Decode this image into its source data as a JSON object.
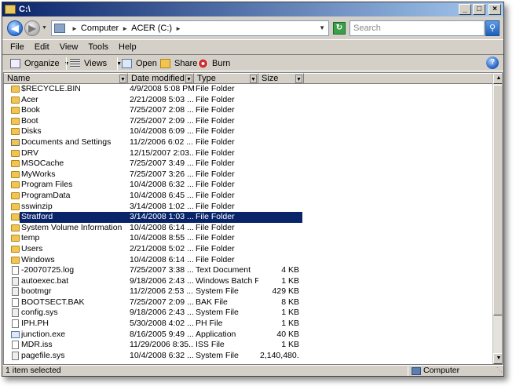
{
  "window": {
    "title": "C:\\"
  },
  "address": {
    "segments": [
      "Computer",
      "ACER (C:)"
    ],
    "search_placeholder": "Search"
  },
  "menu": [
    "File",
    "Edit",
    "View",
    "Tools",
    "Help"
  ],
  "toolbar": {
    "organize": "Organize",
    "views": "Views",
    "open": "Open",
    "share": "Share",
    "burn": "Burn"
  },
  "columns": [
    "Name",
    "Date modified",
    "Type",
    "Size"
  ],
  "files": [
    {
      "name": "$RECYCLE.BIN",
      "date": "4/9/2008 5:08 PM",
      "type": "File Folder",
      "size": "",
      "icon": "folder-icon"
    },
    {
      "name": "Acer",
      "date": "2/21/2008 5:03 ...",
      "type": "File Folder",
      "size": "",
      "icon": "folder-icon"
    },
    {
      "name": "Book",
      "date": "7/25/2007 2:08 ...",
      "type": "File Folder",
      "size": "",
      "icon": "folder-icon"
    },
    {
      "name": "Boot",
      "date": "7/25/2007 2:09 ...",
      "type": "File Folder",
      "size": "",
      "icon": "folder-icon"
    },
    {
      "name": "Disks",
      "date": "10/4/2008 6:09 ...",
      "type": "File Folder",
      "size": "",
      "icon": "folder-icon"
    },
    {
      "name": "Documents and Settings",
      "date": "11/2/2006 6:02 ...",
      "type": "File Folder",
      "size": "",
      "icon": "shortcut-folder-icon"
    },
    {
      "name": "DRV",
      "date": "12/15/2007 2:03...",
      "type": "File Folder",
      "size": "",
      "icon": "folder-icon"
    },
    {
      "name": "MSOCache",
      "date": "7/25/2007 3:49 ...",
      "type": "File Folder",
      "size": "",
      "icon": "folder-icon"
    },
    {
      "name": "MyWorks",
      "date": "7/25/2007 3:26 ...",
      "type": "File Folder",
      "size": "",
      "icon": "folder-icon"
    },
    {
      "name": "Program Files",
      "date": "10/4/2008 6:32 ...",
      "type": "File Folder",
      "size": "",
      "icon": "folder-icon"
    },
    {
      "name": "ProgramData",
      "date": "10/4/2008 6:45 ...",
      "type": "File Folder",
      "size": "",
      "icon": "folder-icon"
    },
    {
      "name": "sswinzip",
      "date": "3/14/2008 1:02 ...",
      "type": "File Folder",
      "size": "",
      "icon": "folder-icon"
    },
    {
      "name": "Stratford",
      "date": "3/14/2008 1:03 ...",
      "type": "File Folder",
      "size": "",
      "icon": "folder-icon",
      "selected": true
    },
    {
      "name": "System Volume Information",
      "date": "10/4/2008 6:14 ...",
      "type": "File Folder",
      "size": "",
      "icon": "folder-icon"
    },
    {
      "name": "temp",
      "date": "10/4/2008 8:55 ...",
      "type": "File Folder",
      "size": "",
      "icon": "folder-icon"
    },
    {
      "name": "Users",
      "date": "2/21/2008 5:02 ...",
      "type": "File Folder",
      "size": "",
      "icon": "folder-icon"
    },
    {
      "name": "Windows",
      "date": "10/4/2008 6:14 ...",
      "type": "File Folder",
      "size": "",
      "icon": "folder-icon"
    },
    {
      "name": "-20070725.log",
      "date": "7/25/2007 3:38 ...",
      "type": "Text Document",
      "size": "4 KB",
      "icon": "text-file-icon"
    },
    {
      "name": "autoexec.bat",
      "date": "9/18/2006 2:43 ...",
      "type": "Windows Batch F...",
      "size": "1 KB",
      "icon": "batch-file-icon"
    },
    {
      "name": "bootmgr",
      "date": "11/2/2006 2:53 ...",
      "type": "System File",
      "size": "429 KB",
      "icon": "system-file-icon"
    },
    {
      "name": "BOOTSECT.BAK",
      "date": "7/25/2007 2:09 ...",
      "type": "BAK File",
      "size": "8 KB",
      "icon": "file-icon"
    },
    {
      "name": "config.sys",
      "date": "9/18/2006 2:43 ...",
      "type": "System File",
      "size": "1 KB",
      "icon": "system-file-icon"
    },
    {
      "name": "IPH.PH",
      "date": "5/30/2008 4:02 ...",
      "type": "PH File",
      "size": "1 KB",
      "icon": "file-icon"
    },
    {
      "name": "junction.exe",
      "date": "8/16/2005 9:49 ...",
      "type": "Application",
      "size": "40 KB",
      "icon": "application-icon"
    },
    {
      "name": "MDR.iss",
      "date": "11/29/2006 8:35...",
      "type": "ISS File",
      "size": "1 KB",
      "icon": "file-icon"
    },
    {
      "name": "pagefile.sys",
      "date": "10/4/2008 6:32 ...",
      "type": "System File",
      "size": "2,140,480...",
      "icon": "system-file-icon"
    }
  ],
  "status": {
    "left": "1 item selected",
    "right": "Computer"
  }
}
